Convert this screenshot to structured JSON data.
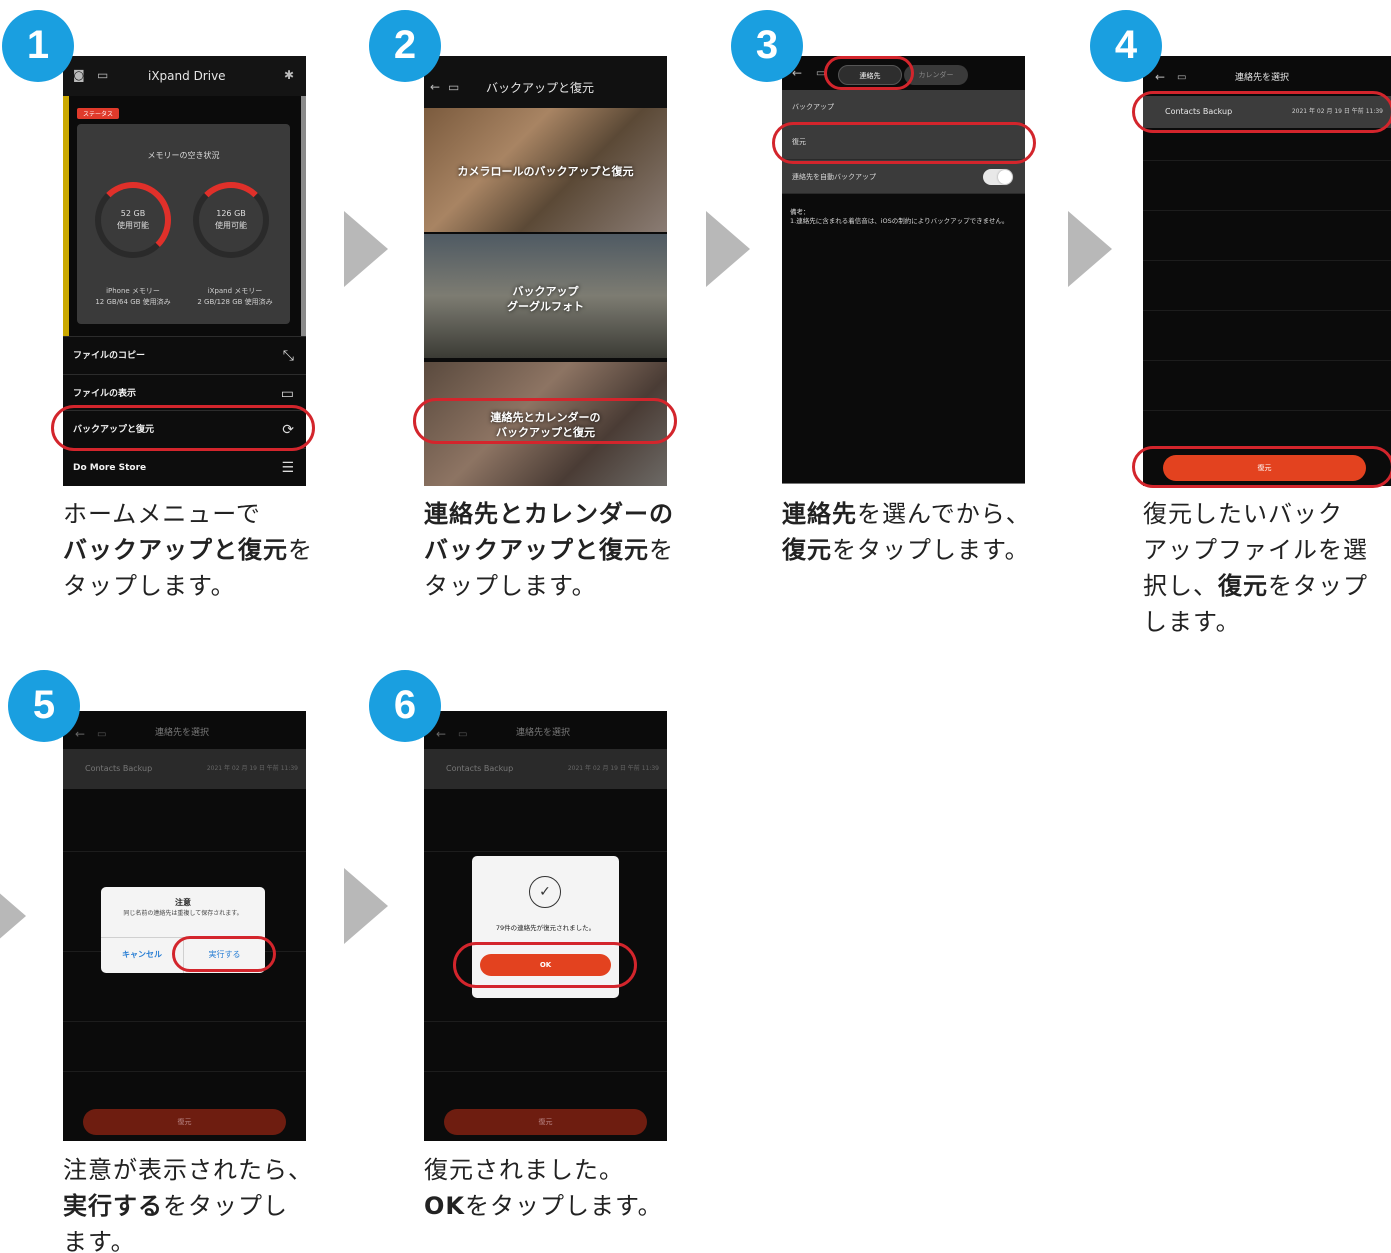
{
  "steps": [
    {
      "number": "1",
      "caption": {
        "line1": "ホームメニューで",
        "line2_bold": "バックアップと復元",
        "line2_rest": "を",
        "line3": "タップします。"
      },
      "screen": {
        "title": "iXpand Drive",
        "status_badge": "ステータス",
        "panel_title": "メモリーの空き状況",
        "ring_left_value": "52 GB",
        "ring_left_sub": "使用可能",
        "ring_right_value": "126 GB",
        "ring_right_sub": "使用可能",
        "cap_left_title": "iPhone メモリー",
        "cap_left_sub": "12 GB/64 GB 使用済み",
        "cap_right_title": "iXpand メモリー",
        "cap_right_sub": "2 GB/128 GB 使用済み",
        "menu": [
          "ファイルのコピー",
          "ファイルの表示",
          "バックアップと復元",
          "Do More Store"
        ]
      }
    },
    {
      "number": "2",
      "caption": {
        "line1_bold": "連絡先とカレンダーの",
        "line2_bold": "バックアップと復元",
        "line2_rest": "を",
        "line3": "タップします。"
      },
      "screen": {
        "title": "バックアップと復元",
        "card1": "カメラロールのバックアップと復元",
        "card2_line1": "バックアップ",
        "card2_line2": "グーグルフォト",
        "card3_line1": "連絡先とカレンダーの",
        "card3_line2": "バックアップと復元"
      }
    },
    {
      "number": "3",
      "caption": {
        "line1_bold": "連絡先",
        "line1_rest": "を選んでから、",
        "line2_bold": "復元",
        "line2_rest": "をタップします。"
      },
      "screen": {
        "tab_active": "連絡先",
        "tab_inactive": "カレンダー",
        "row_backup": "バックアップ",
        "row_restore": "復元",
        "row_auto": "連絡先を自動バックアップ",
        "note_line1": "備考：",
        "note_line2": "1.連絡先に含まれる着信音は、iOSの制約によりバックアップできません。"
      }
    },
    {
      "number": "4",
      "caption": {
        "line1": "復元したいバック",
        "line2": "アップファイルを選",
        "line3_pre": "択し、",
        "line3_bold": "復元",
        "line3_rest": "をタップ",
        "line4": "します。"
      },
      "screen": {
        "title": "連絡先を選択",
        "backup_name": "Contacts Backup",
        "backup_date": "2021 年 02 月 19 日 午前 11:39",
        "restore_button": "復元"
      }
    },
    {
      "number": "5",
      "caption": {
        "line1": "注意が表示されたら、",
        "line2_bold": "実行する",
        "line2_rest": "をタップし",
        "line3": "ます。"
      },
      "screen": {
        "title": "連絡先を選択",
        "backup_name": "Contacts Backup",
        "backup_date": "2021 年 02 月 19 日 午前 11:39",
        "dialog_title": "注意",
        "dialog_message": "同じ名前の連絡先は重複して保存されます。",
        "cancel_button": "キャンセル",
        "execute_button": "実行する",
        "restore_button": "復元"
      }
    },
    {
      "number": "6",
      "caption": {
        "line1": "復元されました。",
        "line2_bold": "OK",
        "line2_rest": "をタップします。"
      },
      "screen": {
        "title": "連絡先を選択",
        "backup_name": "Contacts Backup",
        "backup_date": "2021 年 02 月 19 日 午前 11:39",
        "dialog_message": "79件の連絡先が復元されました。",
        "ok_button": "OK",
        "restore_button": "復元"
      }
    }
  ],
  "colors": {
    "badge": "#1a9fe0",
    "highlight_ring": "#d3252c",
    "accent_button": "#e3421f",
    "arrow": "#b8b8b8"
  },
  "icons": [
    "camera-icon",
    "cast-icon",
    "gear-icon",
    "back-arrow-icon",
    "copy-icon",
    "folder-icon",
    "sync-icon",
    "menu-icon",
    "check-circle-icon"
  ]
}
